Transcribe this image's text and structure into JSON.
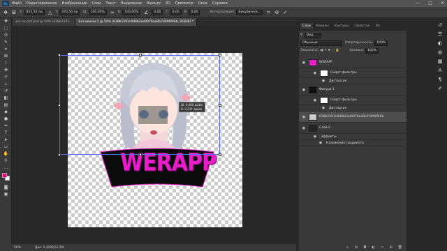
{
  "menubar": {
    "logo": "Ps",
    "items": [
      "Файл",
      "Редактирование",
      "Изображение",
      "Слои",
      "Текст",
      "Выделение",
      "Фильтр",
      "3D",
      "Просмотр",
      "Окно",
      "Справка"
    ],
    "win_buttons": [
      "—",
      "□",
      "✕"
    ]
  },
  "options": {
    "x_label": "X:",
    "x_value": "815,50 пи",
    "y_label": "Y:",
    "y_value": "470,50 пи",
    "w_label": "Ш:",
    "w_value": "100,00%",
    "h_label": "В:",
    "h_value": "100,00%",
    "angle_value": "0,00",
    "hskew_label": "Г:",
    "hskew_value": "0,00",
    "vskew_label": "В:",
    "vskew_value": "0,00",
    "interp_label": "Интерполяция:",
    "interp_value": "Бикубическ...",
    "cancel_icon": "⊘",
    "commit_icon": "✓"
  },
  "doc_tabs": [
    "xxx xx pxll.psd @ 50% (638b1593...",
    "Без имени-1 @ 50% (638b1593c0d6b2ed407baa0b7d096f46b, RGB/8) *"
  ],
  "tooltip": {
    "line1": "Ш: 0,060 дюйм",
    "line2": "В: 0,237 дюйм"
  },
  "banner": {
    "text": "WERAPP"
  },
  "status": {
    "zoom": "50%",
    "doc": "Док: 6,46М/22,2М"
  },
  "panel_tabs": [
    "Слои",
    "Каналы",
    "Контуры",
    "Свойства",
    "3D"
  ],
  "layers_panel": {
    "search_label": "Вид",
    "blend_mode": "Обычные",
    "opacity_label": "Непрозрачность:",
    "opacity_value": "100%",
    "lock_label": "Закрепить:",
    "fill_label": "Заливка:",
    "fill_value": "100%",
    "layers": [
      {
        "name": "WERAPP",
        "kind": "smart"
      },
      {
        "name": "Смарт-фильтры",
        "kind": "filter"
      },
      {
        "name": "Дисторсия",
        "kind": "sub"
      },
      {
        "name": "Фигура 1",
        "kind": "smart"
      },
      {
        "name": "Смарт-фильтры",
        "kind": "filter"
      },
      {
        "name": "Дисторсия",
        "kind": "sub"
      },
      {
        "name": "638b1593c0d6b2ed407baa0b7d096f46b",
        "kind": "image"
      },
      {
        "name": "Слой 0",
        "kind": "layer"
      },
      {
        "name": "Эффекты",
        "kind": "sub"
      },
      {
        "name": "Наложение градиента",
        "kind": "sub"
      }
    ]
  },
  "colors": {
    "fg": "#e6007a",
    "bg": "#ffffff",
    "accent": "#e61ec8",
    "selection": "#5a6cff"
  }
}
